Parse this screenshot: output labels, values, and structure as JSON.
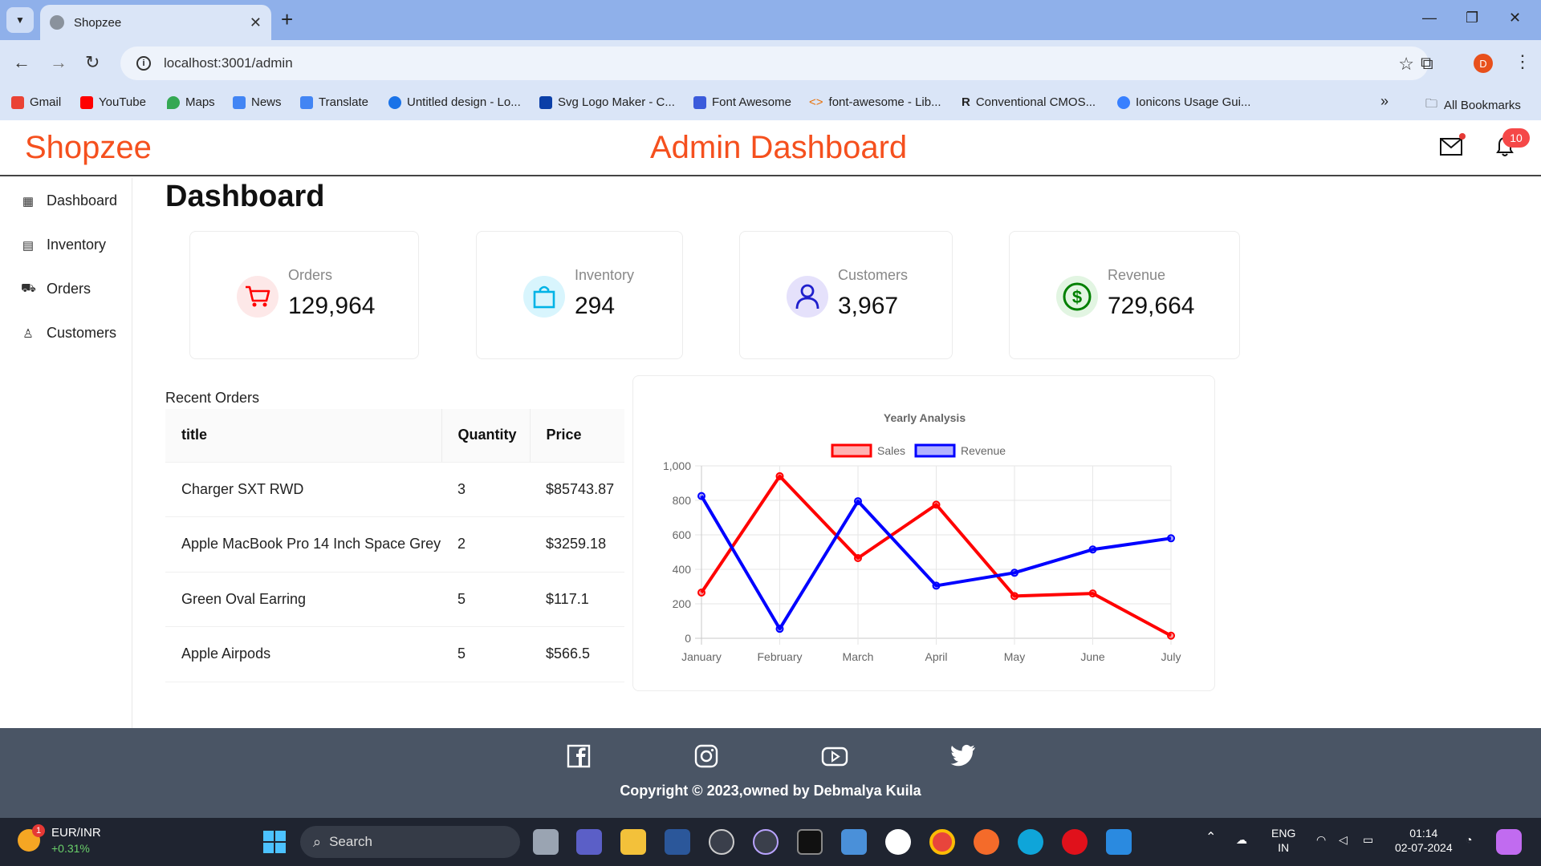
{
  "browser": {
    "tab_title": "Shopzee",
    "url": "localhost:3001/admin",
    "profile_initial": "D",
    "bookmarks": [
      {
        "label": "Gmail",
        "color": "#ea4335"
      },
      {
        "label": "YouTube",
        "color": "#ff0000"
      },
      {
        "label": "Maps",
        "color": "#34a853"
      },
      {
        "label": "News",
        "color": "#4285f4"
      },
      {
        "label": "Translate",
        "color": "#4285f4"
      },
      {
        "label": "Untitled design - Lo...",
        "color": "#1a73e8"
      },
      {
        "label": "Svg Logo Maker - C...",
        "color": "#0b3fa8"
      },
      {
        "label": "Font Awesome",
        "color": "#3b5bdb"
      },
      {
        "label": "font-awesome - Lib...",
        "color": "#e8710a"
      },
      {
        "label": "Conventional CMOS...",
        "color": "#333333"
      },
      {
        "label": "Ionicons Usage Gui...",
        "color": "#3880ff"
      }
    ],
    "all_bookmarks": "All Bookmarks"
  },
  "header": {
    "brand": "Shopzee",
    "title": "Admin Dashboard",
    "notification_count": "10"
  },
  "sidebar": {
    "items": [
      {
        "label": "Dashboard",
        "icon": "grid-icon"
      },
      {
        "label": "Inventory",
        "icon": "shop-icon"
      },
      {
        "label": "Orders",
        "icon": "cart-icon"
      },
      {
        "label": "Customers",
        "icon": "user-icon"
      }
    ]
  },
  "page": {
    "title": "Dashboard",
    "cards": [
      {
        "label": "Orders",
        "value": "129,964",
        "icon": "cart-icon",
        "color": "#ff0000",
        "bg": "#fde8e8"
      },
      {
        "label": "Inventory",
        "value": "294",
        "icon": "shopping-bag-icon",
        "color": "#00b3e6",
        "bg": "#d8f5fd"
      },
      {
        "label": "Customers",
        "value": "3,967",
        "icon": "user-icon",
        "color": "#1f1fcc",
        "bg": "#e5e1fb"
      },
      {
        "label": "Revenue",
        "value": "729,664",
        "icon": "dollar-icon",
        "color": "#008000",
        "bg": "#e2f5e2"
      }
    ],
    "recent_orders": {
      "label": "Recent Orders",
      "columns": [
        "title",
        "Quantity",
        "Price"
      ],
      "rows": [
        [
          "Charger SXT RWD",
          "3",
          "$85743.87"
        ],
        [
          "Apple MacBook Pro 14 Inch Space Grey",
          "2",
          "$3259.18"
        ],
        [
          "Green Oval Earring",
          "5",
          "$117.1"
        ],
        [
          "Apple Airpods",
          "5",
          "$566.5"
        ]
      ]
    }
  },
  "chart_data": {
    "type": "line",
    "title": "Yearly Analysis",
    "categories": [
      "January",
      "February",
      "March",
      "April",
      "May",
      "June",
      "July"
    ],
    "series": [
      {
        "name": "Sales",
        "color": "#ff0000",
        "values": [
          265,
          940,
          465,
          775,
          245,
          260,
          15
        ]
      },
      {
        "name": "Revenue",
        "color": "#0000ff",
        "values": [
          825,
          55,
          795,
          305,
          380,
          515,
          580
        ]
      }
    ],
    "ylim": [
      0,
      1000
    ],
    "yticks": [
      "0",
      "200",
      "400",
      "600",
      "800",
      "1,000"
    ],
    "grid": true,
    "legend": "top-center"
  },
  "footer": {
    "copyright": "Copyright © 2023,owned by Debmalya Kuila"
  },
  "taskbar": {
    "ticker_pair": "EUR/INR",
    "ticker_change": "+0.31%",
    "ticker_badge": "1",
    "search_label": "Search",
    "lang_1": "ENG",
    "lang_2": "IN",
    "time": "01:14",
    "date": "02-07-2024"
  }
}
